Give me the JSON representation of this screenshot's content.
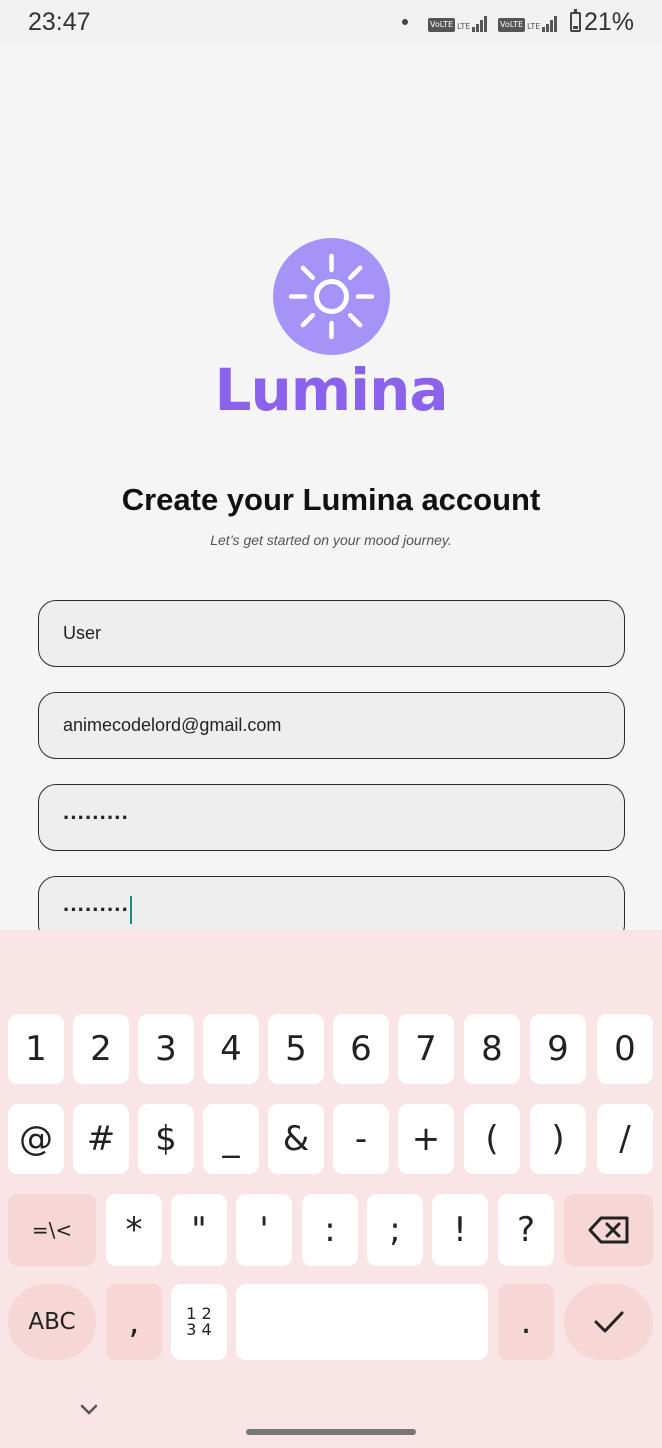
{
  "status_bar": {
    "time": "23:47",
    "volte_1": "VoLTE",
    "lte_1": "LTE",
    "volte_2": "VoLTE",
    "lte_2": "LTE",
    "battery_level": 0.21,
    "battery_percent": "21%"
  },
  "logo": {
    "icon": "sun-icon",
    "brand_name": "Lumina",
    "color": "#8a62ec",
    "circle_color": "#a693f7"
  },
  "header": {
    "title": "Create your Lumina account",
    "subtitle": "Let’s get started on your mood journey."
  },
  "form": {
    "name_value": "User",
    "email_value": "animecodelord@gmail.com",
    "password_value": "·········",
    "confirm_password_value": "·········"
  },
  "keyboard": {
    "row1": [
      "1",
      "2",
      "3",
      "4",
      "5",
      "6",
      "7",
      "8",
      "9",
      "0"
    ],
    "row2": [
      "@",
      "#",
      "$",
      "_",
      "&",
      "-",
      "+",
      "(",
      ")",
      "/"
    ],
    "row3_fn": "=\\<",
    "row3": [
      "*",
      "\"",
      "'",
      ":",
      ";",
      "!",
      "?"
    ],
    "backspace_icon": "backspace-icon",
    "abc": "ABC",
    "comma": ",",
    "numpad_top": "1 2",
    "numpad_bottom": "3 4",
    "period": ".",
    "enter_icon": "check-icon",
    "hide_icon": "chevron-down-icon"
  }
}
